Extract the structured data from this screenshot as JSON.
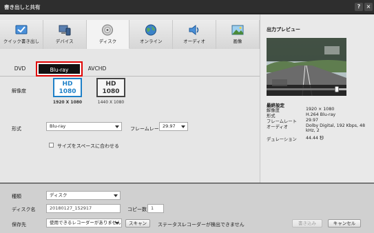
{
  "window": {
    "title": "書き出しと共有",
    "help_label": "?",
    "close_label": "×"
  },
  "tabs": [
    {
      "label": "クイック書き出し",
      "icon": "quick-export-icon"
    },
    {
      "label": "デバイス",
      "icon": "device-icon"
    },
    {
      "label": "ディスク",
      "icon": "disc-icon"
    },
    {
      "label": "オンライン",
      "icon": "globe-icon"
    },
    {
      "label": "オーディオ",
      "icon": "speaker-icon"
    },
    {
      "label": "画像",
      "icon": "image-icon"
    }
  ],
  "active_tab": "ディスク",
  "subtabs": {
    "dvd": "DVD",
    "bluray": "Blu-ray",
    "avchd": "AVCHD"
  },
  "resolution": {
    "label": "解像度",
    "options": [
      {
        "line1": "HD",
        "line2": "1080",
        "caption": "1920 X 1080"
      },
      {
        "line1": "HD",
        "line2": "1080",
        "caption": "1440 X 1080"
      }
    ]
  },
  "format": {
    "label": "形式",
    "value": "Blu-ray"
  },
  "framerate": {
    "label": "フレームレート",
    "value": "29.97"
  },
  "fit_checkbox": {
    "label": "サイズをスペースに合わせる",
    "checked": false
  },
  "preview": {
    "title": "出力プレビュー",
    "progress": 0.88,
    "settings_heading": "最終設定",
    "rows": [
      {
        "key": "解像度",
        "value": "1920 × 1080"
      },
      {
        "key": "形式",
        "value": "H.264 Blu-ray"
      },
      {
        "key": "フレームレート",
        "value": "29.97"
      },
      {
        "key": "オーディオ",
        "value": "Dolby Digital, 192 Kbps, 48 kHz, 2"
      },
      {
        "key": "デュレーション",
        "value": "44.44 秒"
      }
    ]
  },
  "bottom": {
    "type_label": "種類",
    "type_value": "ディスク",
    "disc_name_label": "ディスク名",
    "disc_name_value": "20180127_152917",
    "copies_label": "コピー数",
    "copies_value": "1",
    "save_to_label": "保存先",
    "save_to_value": "使用できるレコーダーがありません",
    "scan_button": "スキャン",
    "status_label": "ステータス:",
    "status_value": "レコーダーが検出できません",
    "export_button": "書き込み",
    "cancel_button": "キャンセル"
  },
  "colors": {
    "accent_blue": "#1e80c8",
    "highlight_red": "#e00000"
  }
}
